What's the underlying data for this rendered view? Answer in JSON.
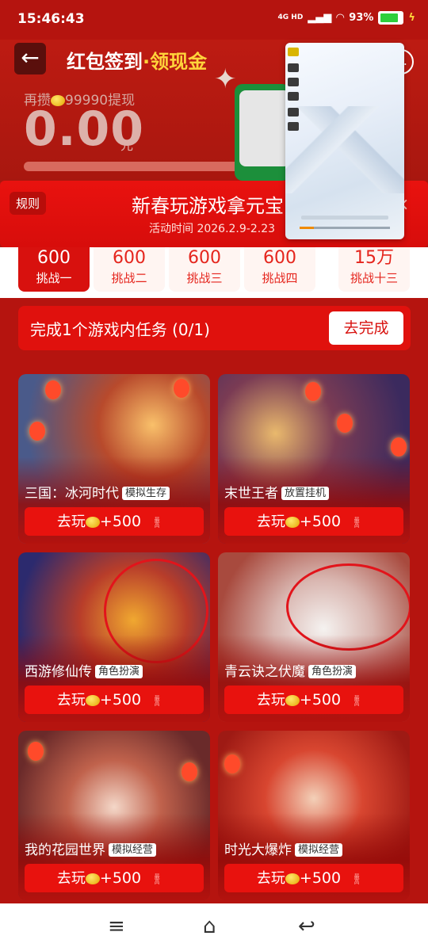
{
  "status": {
    "time": "15:46:43",
    "network": "4G HD",
    "battery": "93%"
  },
  "header": {
    "title_main": "红包签到",
    "title_dot": "·",
    "title_accent": "领现金",
    "save_prefix": "再攒",
    "save_amount": "99990",
    "save_suffix": "提现",
    "balance": "0.00",
    "balance_unit": "元"
  },
  "banner": {
    "rules": "规则",
    "title": "新春玩游戏拿元宝",
    "time": "活动时间 2026.2.9-2.23"
  },
  "tabs": [
    {
      "value": "600",
      "label": "挑战一"
    },
    {
      "value": "600",
      "label": "挑战二"
    },
    {
      "value": "600",
      "label": "挑战三"
    },
    {
      "value": "600",
      "label": "挑战四"
    },
    {
      "value": "15万",
      "label": "挑战十三"
    }
  ],
  "task": {
    "text": "完成1个游戏内任务 (0/1)",
    "button": "去完成"
  },
  "games": [
    {
      "name": "三国：冰河时代",
      "tag": "模拟生存",
      "play": "去玩",
      "reward": "+500",
      "cap": "最高"
    },
    {
      "name": "末世王者",
      "tag": "放置挂机",
      "play": "去玩",
      "reward": "+500",
      "cap": "最高"
    },
    {
      "name": "西游修仙传",
      "tag": "角色扮演",
      "play": "去玩",
      "reward": "+500",
      "cap": "最高"
    },
    {
      "name": "青云诀之伏魔",
      "tag": "角色扮演",
      "play": "去玩",
      "reward": "+500",
      "cap": "最高"
    },
    {
      "name": "我的花园世界",
      "tag": "模拟经营",
      "play": "去玩",
      "reward": "+500",
      "cap": "最高"
    },
    {
      "name": "时光大爆炸",
      "tag": "模拟经营",
      "play": "去玩",
      "reward": "+500",
      "cap": "最高"
    }
  ],
  "icons": {
    "back": "arrow-left-icon",
    "more": "more-icon",
    "menu": "menu-icon",
    "home": "home-icon",
    "return": "back-icon"
  }
}
